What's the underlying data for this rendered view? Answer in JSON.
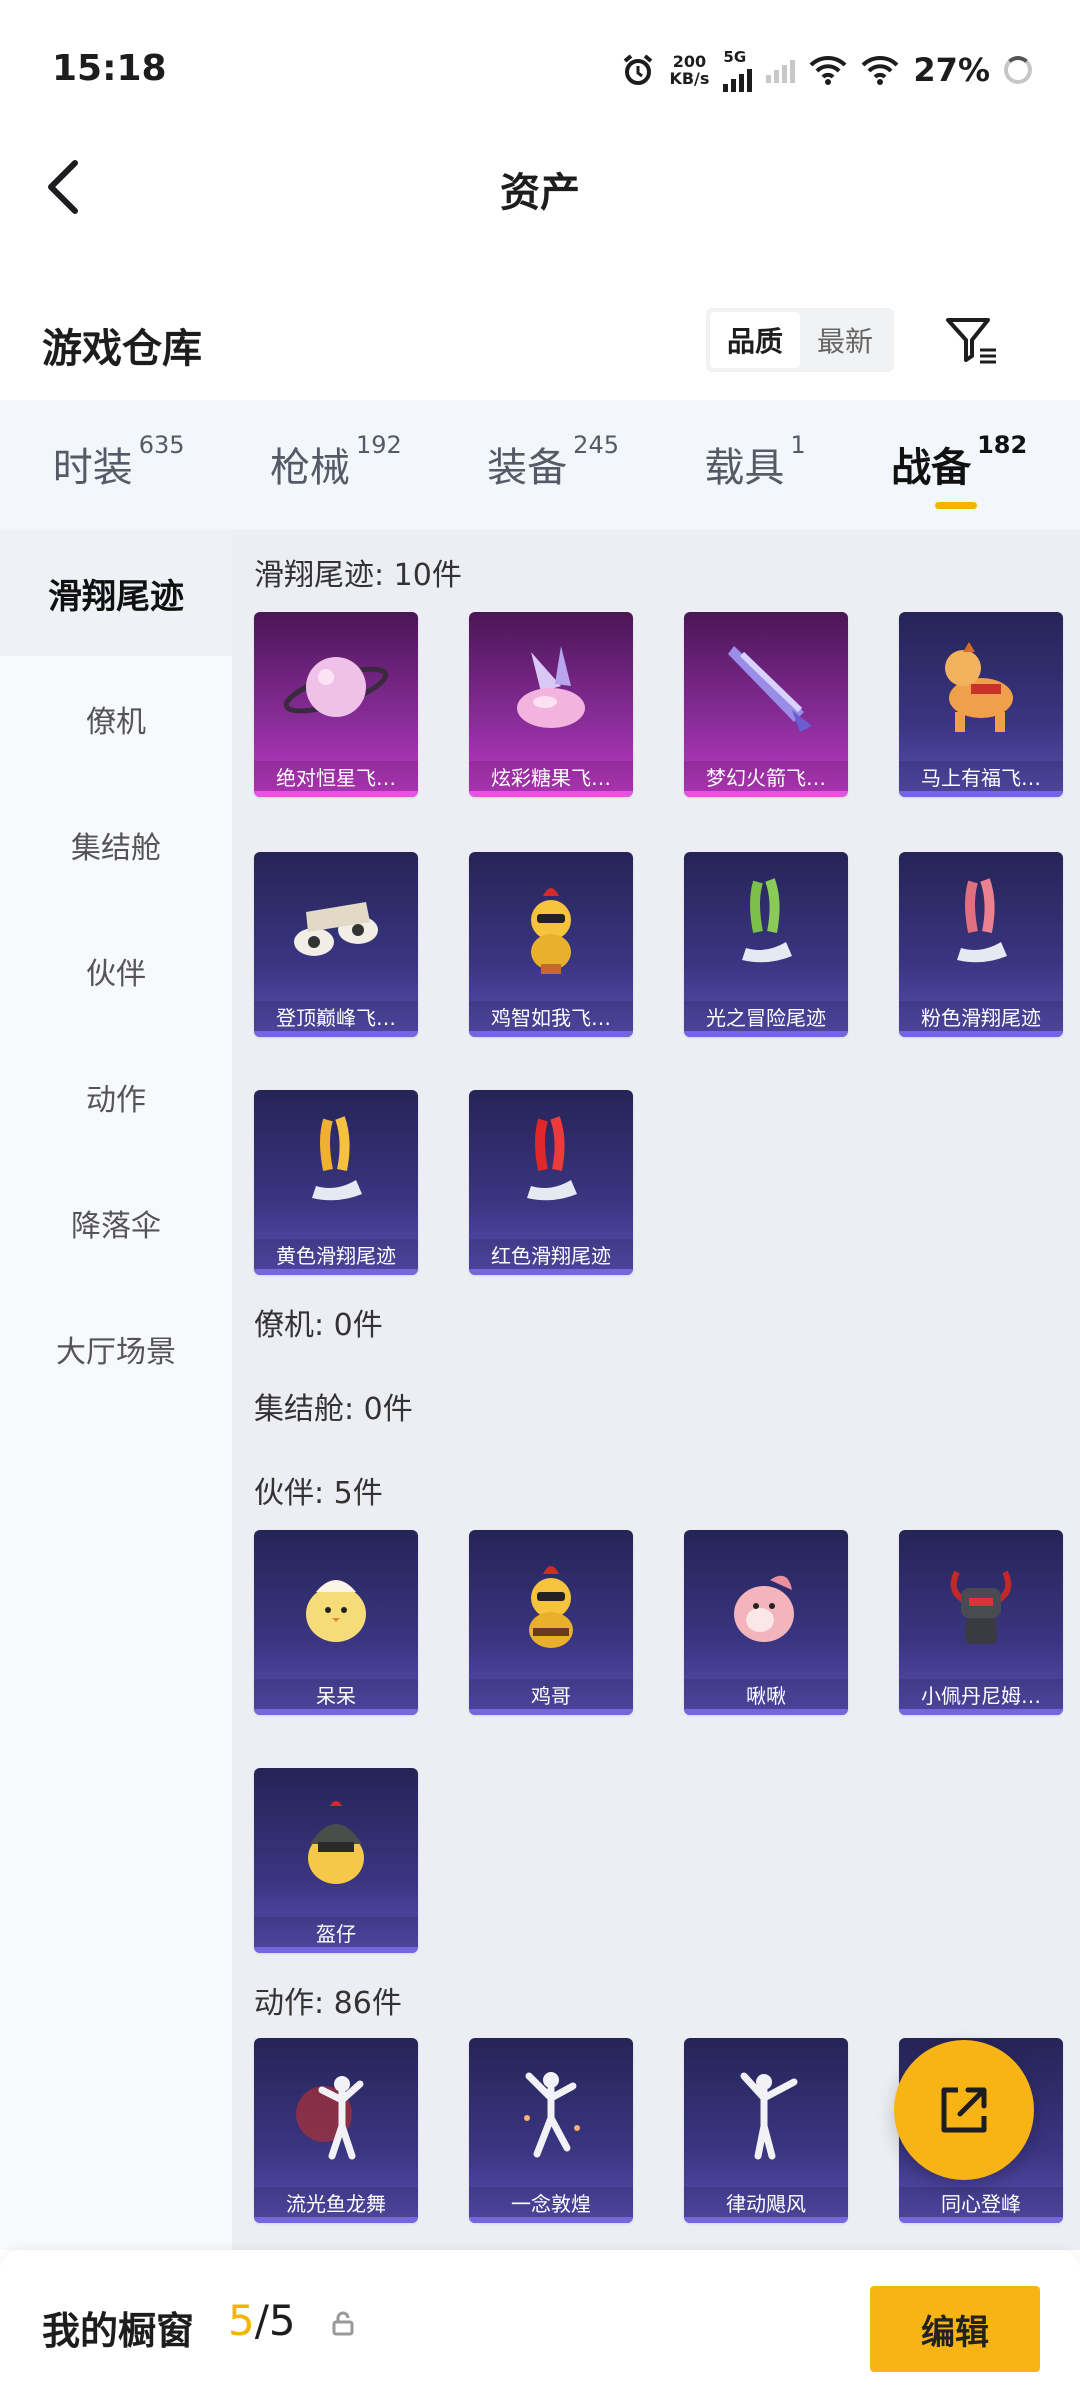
{
  "status": {
    "time": "15:18",
    "net_rate_top": "200",
    "net_rate_bottom": "KB/s",
    "net_type": "5G",
    "battery": "27%"
  },
  "header": {
    "title": "资产"
  },
  "warehouse": {
    "title": "游戏仓库",
    "sort": [
      "品质",
      "最新"
    ],
    "sort_active": "品质"
  },
  "tabs": [
    {
      "label": "时装",
      "count": "635"
    },
    {
      "label": "枪械",
      "count": "192"
    },
    {
      "label": "装备",
      "count": "245"
    },
    {
      "label": "载具",
      "count": "1"
    },
    {
      "label": "战备",
      "count": "182",
      "active": true
    }
  ],
  "side_nav": [
    "滑翔尾迹",
    "僚机",
    "集结舱",
    "伙伴",
    "动作",
    "降落伞",
    "大厅场景"
  ],
  "groups": {
    "glide": {
      "title": "滑翔尾迹: 10件",
      "items": [
        "绝对恒星飞…",
        "炫彩糖果飞…",
        "梦幻火箭飞…",
        "马上有福飞…",
        "登顶巅峰飞…",
        "鸡智如我飞…",
        "光之冒险尾迹",
        "粉色滑翔尾迹",
        "黄色滑翔尾迹",
        "红色滑翔尾迹"
      ]
    },
    "wingman": {
      "title": "僚机: 0件"
    },
    "pod": {
      "title": "集结舱: 0件"
    },
    "partner": {
      "title": "伙伴: 5件",
      "items": [
        "呆呆",
        "鸡哥",
        "啾啾",
        "小佩丹尼姆…",
        "盔仔"
      ]
    },
    "emote": {
      "title": "动作: 86件",
      "items": [
        "流光鱼龙舞",
        "一念敦煌",
        "律动飓风",
        "同心登峰"
      ]
    }
  },
  "colors": {
    "accent": "#f5b400",
    "card_blue": "#3a3581",
    "card_pink": "#8a2d9a"
  },
  "showcase": {
    "label": "我的橱窗",
    "current": "5",
    "sep": "/",
    "total": "5",
    "edit_label": "编辑"
  }
}
